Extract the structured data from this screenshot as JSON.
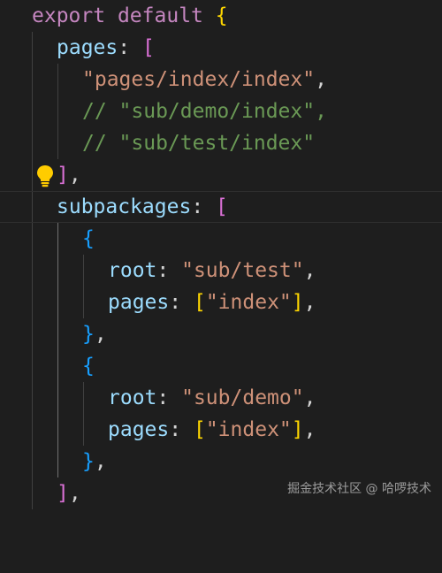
{
  "colors": {
    "background": "#1e1e1e",
    "keyword": "#c586c0",
    "property": "#9cdcfe",
    "string": "#ce9178",
    "comment": "#6a9955",
    "bracket_level1": "#ffd700",
    "bracket_level2": "#da70d6",
    "bracket_level3": "#179fff",
    "lightbulb": "#ffcc00"
  },
  "icons": {
    "lightbulb": "lightbulb-icon"
  },
  "code": {
    "l1": {
      "export": "export",
      "default": "default",
      "brace": "{"
    },
    "l2": {
      "key": "pages",
      "colon": ":",
      "bracket": "["
    },
    "l3": {
      "str": "\"pages/index/index\"",
      "comma": ","
    },
    "l4": {
      "comment": "// \"sub/demo/index\","
    },
    "l5": {
      "comment": "// \"sub/test/index\""
    },
    "l6": {
      "bracket": "]",
      "comma": ","
    },
    "l7": {
      "key": "subpackages",
      "colon": ":",
      "bracket": "["
    },
    "l8": {
      "brace": "{"
    },
    "l9": {
      "key": "root",
      "colon": ":",
      "str": "\"sub/test\"",
      "comma": ","
    },
    "l10": {
      "key": "pages",
      "colon": ":",
      "open": "[",
      "str": "\"index\"",
      "close": "]",
      "comma": ","
    },
    "l11": {
      "brace": "}",
      "comma": ","
    },
    "l12": {
      "brace": "{"
    },
    "l13": {
      "key": "root",
      "colon": ":",
      "str": "\"sub/demo\"",
      "comma": ","
    },
    "l14": {
      "key": "pages",
      "colon": ":",
      "open": "[",
      "str": "\"index\"",
      "close": "]",
      "comma": ","
    },
    "l15": {
      "brace": "}",
      "comma": ","
    },
    "l16": {
      "bracket": "]",
      "comma": ","
    }
  },
  "watermark": "掘金技术社区 @ 哈啰技术"
}
